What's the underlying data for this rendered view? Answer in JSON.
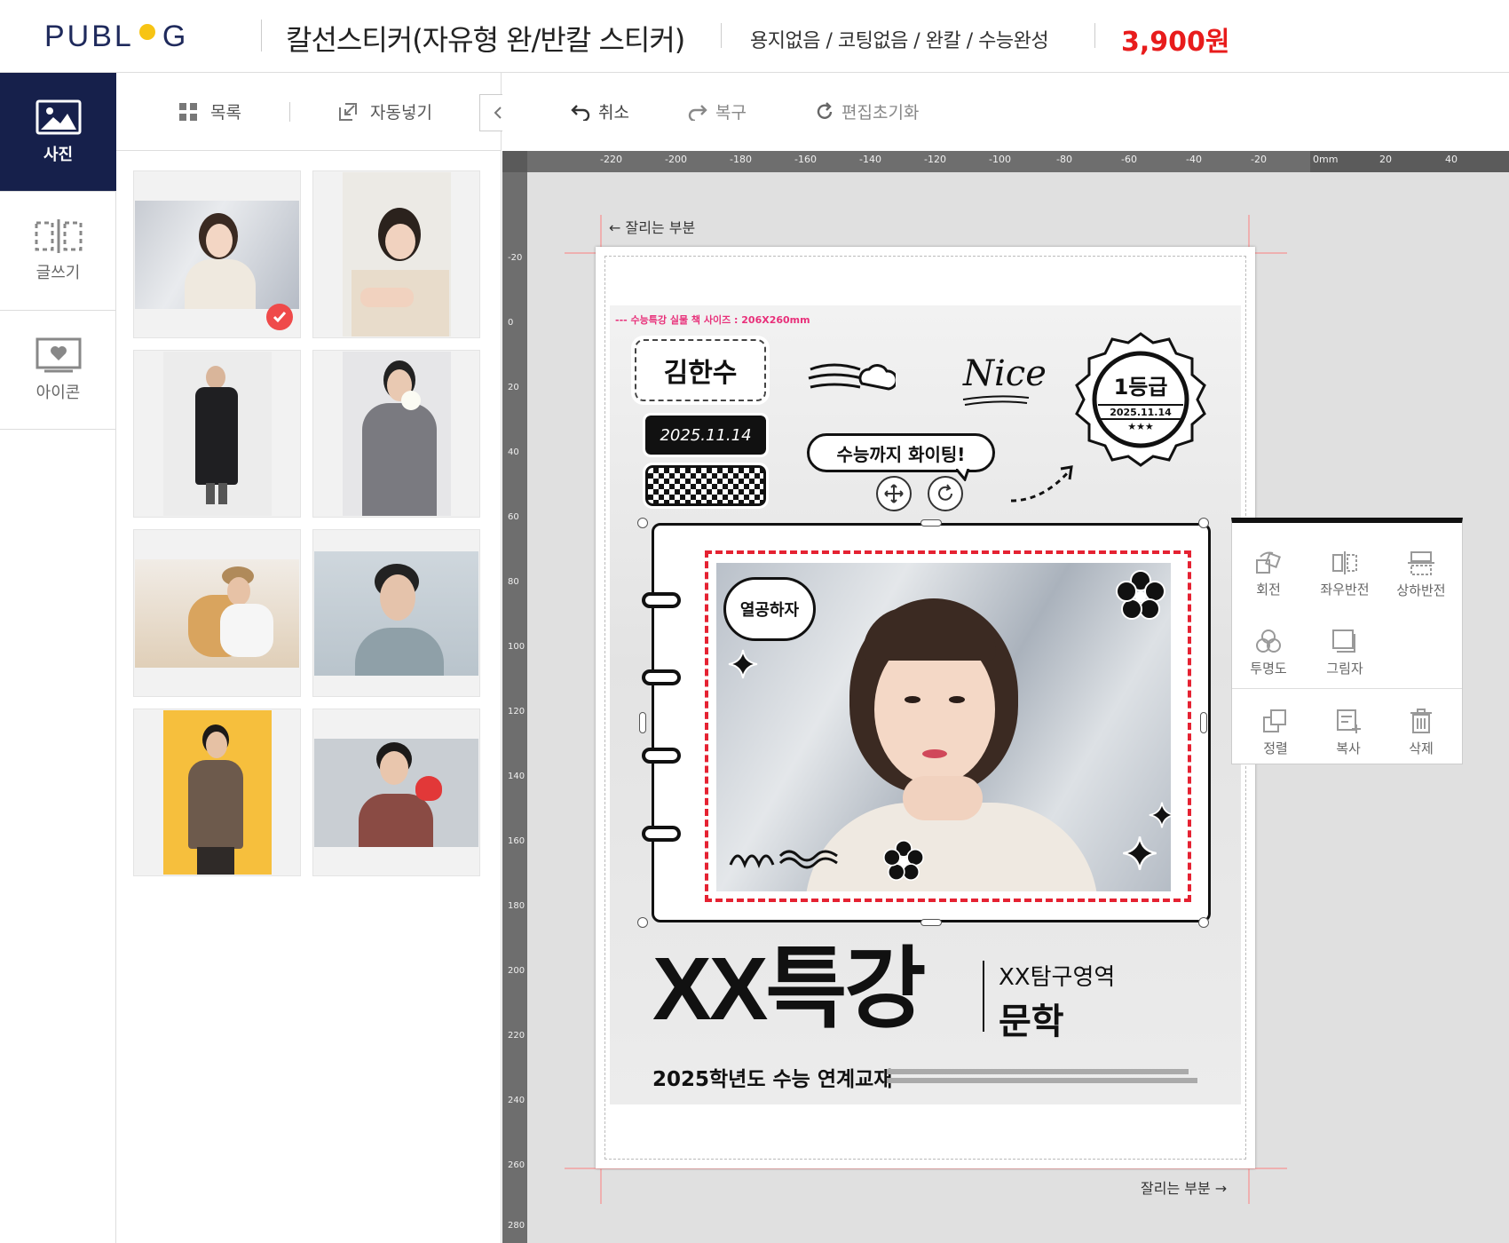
{
  "header": {
    "logo_left": "PUBL",
    "logo_right": "G",
    "product_title": "칼선스티커(자유형 완/반칼 스티커)",
    "product_options": "용지없음 / 코팅없음 / 완칼 / 수능완성",
    "price": "3,900원"
  },
  "colors": {
    "brand_navy": "#16204b",
    "logo_text": "#1f2a5c",
    "logo_dot": "#f7c414",
    "price_red": "#e81c1c",
    "cut_line": "#f3a0a0",
    "dash_red": "#e52232",
    "accent_pink": "#e8307a"
  },
  "left_nav": {
    "items": [
      {
        "label": "사진",
        "icon": "image-icon",
        "active": true
      },
      {
        "label": "글쓰기",
        "icon": "text-icon",
        "active": false
      },
      {
        "label": "아이콘",
        "icon": "sticker-icon",
        "active": false
      }
    ]
  },
  "photo_panel": {
    "list_label": "목록",
    "auto_fill_label": "자동넣기",
    "collapse_icon": "chevron-left-icon",
    "photos": [
      {
        "desc": "woman in white sweater",
        "selected": true
      },
      {
        "desc": "woman lying down in beige coat",
        "selected": false
      },
      {
        "desc": "man in long black coat",
        "selected": false
      },
      {
        "desc": "man in gray knit with flowers",
        "selected": false
      },
      {
        "desc": "man with golden retriever",
        "selected": false
      },
      {
        "desc": "man in gray sweater profile",
        "selected": false
      },
      {
        "desc": "man in brown suit on yellow",
        "selected": false
      },
      {
        "desc": "man in red sweater holding heart",
        "selected": false
      }
    ]
  },
  "editor_toolbar": {
    "undo_label": "취소",
    "redo_label": "복구",
    "reset_label": "편집초기화"
  },
  "ruler": {
    "h_labels": [
      "-220",
      "-200",
      "-180",
      "-160",
      "-140",
      "-120",
      "-100",
      "-80",
      "-60",
      "-40",
      "-20",
      "0mm",
      "20",
      "40"
    ],
    "v_labels": [
      "-20",
      "0",
      "20",
      "40",
      "60",
      "80",
      "100",
      "120",
      "140",
      "160",
      "180",
      "200",
      "220",
      "240",
      "260",
      "280"
    ]
  },
  "canvas": {
    "cut_label_top": "← 잘리는 부분",
    "cut_label_bottom": "잘리는 부분 →",
    "real_size_note": "--- 수능특강 실물 책 사이즈 : 206X260mm",
    "name_tag": "김한수",
    "date_tag": "2025.11.14",
    "nice_text": "Nice",
    "cheer_text": "수능까지 화이팅!",
    "badge_main": "1등급",
    "badge_date": "2025.11.14",
    "badge_stars": "★★★",
    "speech_text": "열공하자",
    "big_title": "XX특강",
    "subject_line1": "XX탐구영역",
    "subject_line2": "문학",
    "textbook_line": "2025학년도 수능 연계교재"
  },
  "context_menu": {
    "items": [
      {
        "label": "회전",
        "icon": "rotate-icon"
      },
      {
        "label": "좌우반전",
        "icon": "flip-horizontal-icon"
      },
      {
        "label": "상하반전",
        "icon": "flip-vertical-icon"
      },
      {
        "label": "투명도",
        "icon": "opacity-icon"
      },
      {
        "label": "그림자",
        "icon": "shadow-icon"
      },
      {
        "label": "정렬",
        "icon": "arrange-icon"
      },
      {
        "label": "복사",
        "icon": "copy-icon"
      },
      {
        "label": "삭제",
        "icon": "trash-icon"
      }
    ]
  }
}
